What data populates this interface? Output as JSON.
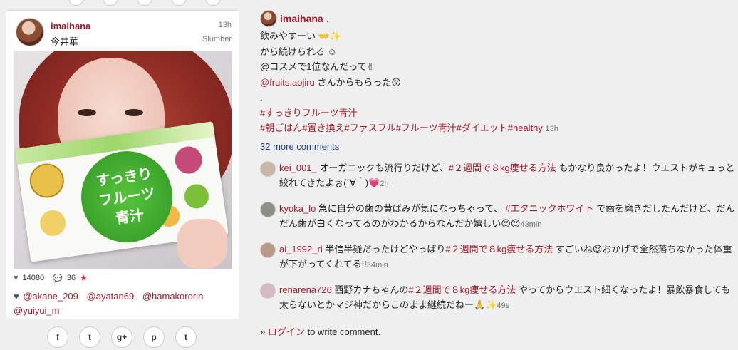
{
  "card": {
    "username": "imaihana",
    "display_name": "今井華",
    "time": "13h",
    "filter": "Slumber",
    "product_text": "すっきり\nフルーツ\n青汁",
    "likes": "14080",
    "comments": "36",
    "likers": [
      "@akane_209",
      "@ayatan69",
      "@hamakororin",
      "@yuiyui_m"
    ]
  },
  "share_buttons": [
    "f",
    "t",
    "g+",
    "p",
    "t"
  ],
  "post": {
    "username": "imaihana",
    "dot": ".",
    "caption_line1": "飲みやすーい 👐✨",
    "caption_line2": "から続けられる ☺",
    "caption_line3": "@コスメで1位なんだって✌",
    "mention": "@fruits.aojiru",
    "mention_suffix": " さんからもらった😚",
    "dot_line": ".",
    "hashtag1": "#すっきりフルーツ青汁",
    "hashtags2": "#朝ごはん#置き換え#ファスフル#フルーツ青汁#ダイエット#healthy",
    "time": "13h",
    "more_comments": "32 more comments"
  },
  "comments": [
    {
      "user": "kei_001_",
      "before": " オーガニックも流行りだけど、",
      "highlight": "#２週間で８kg痩せる方法",
      "after": " もかなり良かったよ！ウエストがキュっと絞れてきたよぉ(´∀｀)💗",
      "time": "2h",
      "avatar_color": "#c9b6a6"
    },
    {
      "user": "kyoka_lo",
      "before": " 急に自分の歯の黄ばみが気になっちゃって、 ",
      "highlight": "#エタニックホワイト",
      "after": " で歯を磨きだしたんだけど、だんだん歯が白くなってるのがわかるからなんだか嬉しい😍😍",
      "time": "43min",
      "avatar_color": "#8d8f88"
    },
    {
      "user": "ai_1992_ri",
      "before": " 半信半疑だったけどやっぱり",
      "highlight": "#２週間で８kg痩せる方法",
      "after": " すごいね😌おかげで全然落ちなかった体重が下がってくれてる!!",
      "time": "34min",
      "avatar_color": "#b89a86"
    },
    {
      "user": "renarena726",
      "before": " 西野カナちゃんの",
      "highlight": "#２週間で８kg痩せる方法",
      "after": " やってからウエスト細くなったよ！暴飲暴食しても太らないとかマジ神だからこのまま継続だねー🙏✨",
      "time": "49s",
      "avatar_color": "#d6b9c4"
    }
  ],
  "login": {
    "prefix": "» ",
    "link": "ログイン",
    "suffix": " to write comment."
  }
}
